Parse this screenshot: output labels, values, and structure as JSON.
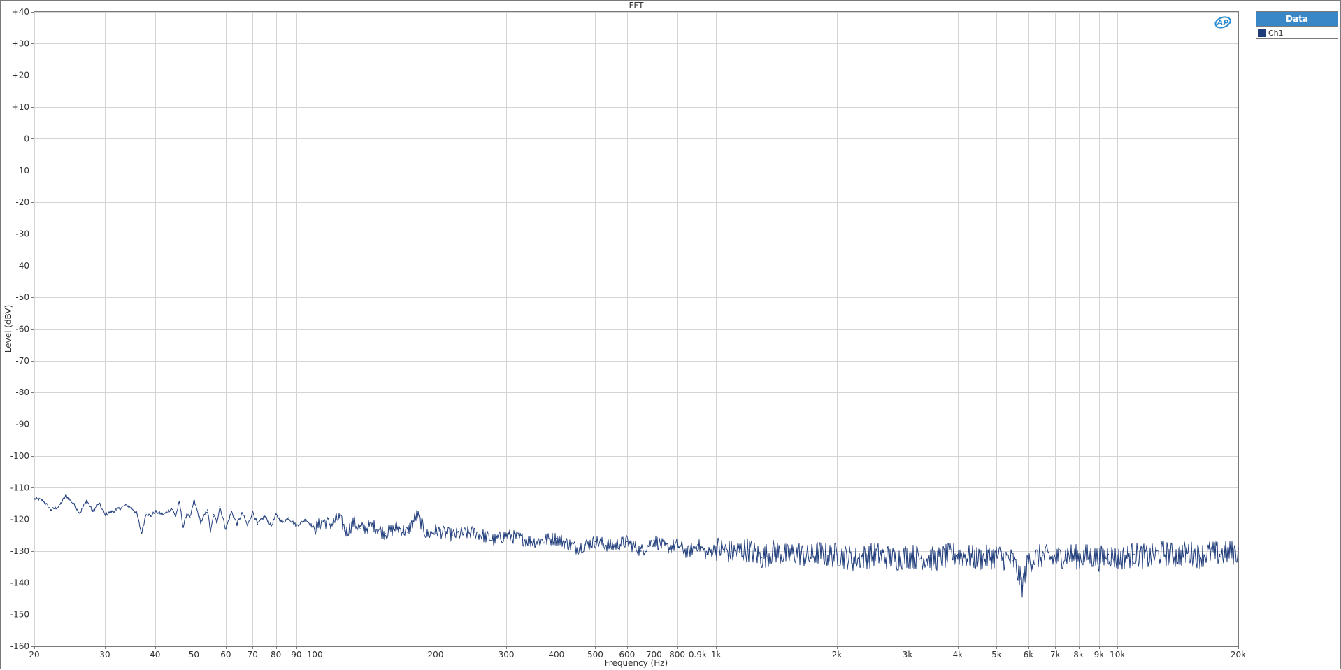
{
  "window": {
    "title": "FFT"
  },
  "legend": {
    "header": "Data",
    "header_color": "#3a87c8",
    "items": [
      {
        "label": "Ch1",
        "color": "#1f3c7a"
      }
    ]
  },
  "logo": {
    "text": "AP",
    "icon": "ap-logo-icon",
    "color": "#2a8bd0"
  },
  "chart_data": {
    "type": "line",
    "title": "FFT",
    "xlabel": "Frequency (Hz)",
    "ylabel": "Level (dBV)",
    "xscale": "log",
    "xlim": [
      20,
      20000
    ],
    "ylim": [
      -160,
      40
    ],
    "grid": true,
    "legend_position": "top-right",
    "x_ticks": [
      {
        "value": 20,
        "label": "20"
      },
      {
        "value": 30,
        "label": "30"
      },
      {
        "value": 40,
        "label": "40"
      },
      {
        "value": 50,
        "label": "50"
      },
      {
        "value": 60,
        "label": "60"
      },
      {
        "value": 70,
        "label": "70"
      },
      {
        "value": 80,
        "label": "80"
      },
      {
        "value": 90,
        "label": "90"
      },
      {
        "value": 100,
        "label": "100"
      },
      {
        "value": 200,
        "label": "200"
      },
      {
        "value": 300,
        "label": "300"
      },
      {
        "value": 400,
        "label": "400"
      },
      {
        "value": 500,
        "label": "500"
      },
      {
        "value": 600,
        "label": "600"
      },
      {
        "value": 700,
        "label": "700"
      },
      {
        "value": 800,
        "label": "800"
      },
      {
        "value": 900,
        "label": "0.9k"
      },
      {
        "value": 1000,
        "label": "1k"
      },
      {
        "value": 2000,
        "label": "2k"
      },
      {
        "value": 3000,
        "label": "3k"
      },
      {
        "value": 4000,
        "label": "4k"
      },
      {
        "value": 5000,
        "label": "5k"
      },
      {
        "value": 6000,
        "label": "6k"
      },
      {
        "value": 7000,
        "label": "7k"
      },
      {
        "value": 8000,
        "label": "8k"
      },
      {
        "value": 9000,
        "label": "9k"
      },
      {
        "value": 10000,
        "label": "10k"
      },
      {
        "value": 20000,
        "label": "20k"
      }
    ],
    "y_ticks": [
      {
        "value": 40,
        "label": "+40"
      },
      {
        "value": 30,
        "label": "+30"
      },
      {
        "value": 20,
        "label": "+20"
      },
      {
        "value": 10,
        "label": "+10"
      },
      {
        "value": 0,
        "label": "0"
      },
      {
        "value": -10,
        "label": "-10"
      },
      {
        "value": -20,
        "label": "-20"
      },
      {
        "value": -30,
        "label": "-30"
      },
      {
        "value": -40,
        "label": "-40"
      },
      {
        "value": -50,
        "label": "-50"
      },
      {
        "value": -60,
        "label": "-60"
      },
      {
        "value": -70,
        "label": "-70"
      },
      {
        "value": -80,
        "label": "-80"
      },
      {
        "value": -90,
        "label": "-90"
      },
      {
        "value": -100,
        "label": "-100"
      },
      {
        "value": -110,
        "label": "-110"
      },
      {
        "value": -120,
        "label": "-120"
      },
      {
        "value": -130,
        "label": "-130"
      },
      {
        "value": -140,
        "label": "-140"
      },
      {
        "value": -150,
        "label": "-150"
      },
      {
        "value": -160,
        "label": "-160"
      }
    ],
    "series": [
      {
        "name": "Ch1",
        "color": "#1f3c7a",
        "x": [
          20,
          21,
          22,
          23,
          24,
          25,
          26,
          27,
          28,
          29,
          30,
          32,
          34,
          35,
          36,
          37,
          38,
          39,
          40,
          42,
          44,
          45,
          46,
          47,
          48,
          49,
          50,
          52,
          54,
          55,
          56,
          57,
          58,
          60,
          62,
          64,
          66,
          68,
          70,
          72,
          75,
          78,
          80,
          83,
          86,
          90,
          95,
          100,
          105,
          110,
          115,
          120,
          125,
          130,
          140,
          150,
          160,
          170,
          180,
          190,
          200,
          220,
          250,
          280,
          300,
          350,
          400,
          450,
          500,
          550,
          600,
          650,
          700,
          750,
          800,
          850,
          900,
          950,
          1000,
          1100,
          1200,
          1300,
          1400,
          1500,
          1600,
          1700,
          1800,
          1900,
          2000,
          2200,
          2500,
          2800,
          3000,
          3500,
          4000,
          4500,
          5000,
          5500,
          5800,
          6000,
          6500,
          7000,
          7500,
          8000,
          8500,
          9000,
          9500,
          10000,
          11000,
          12000,
          13000,
          14000,
          15000,
          16000,
          17000,
          18000,
          19000,
          20000
        ],
        "values": [
          -113.5,
          -114,
          -117,
          -116,
          -112.5,
          -115,
          -118,
          -114,
          -117.5,
          -115,
          -118.5,
          -117,
          -115.5,
          -116.5,
          -118,
          -124.5,
          -118,
          -119,
          -117.5,
          -118.5,
          -116.5,
          -119,
          -114.5,
          -122.5,
          -118,
          -119.5,
          -114,
          -121,
          -117,
          -124,
          -118.5,
          -121,
          -116,
          -123,
          -117.5,
          -121.5,
          -118,
          -122,
          -117.5,
          -121.5,
          -119,
          -122,
          -118.5,
          -121,
          -119.5,
          -122,
          -120,
          -123,
          -120.5,
          -121.5,
          -119.5,
          -124,
          -121,
          -123,
          -122,
          -124.5,
          -122.5,
          -124,
          -118.5,
          -125,
          -123.5,
          -125,
          -124,
          -126.5,
          -125,
          -127,
          -126,
          -129,
          -127,
          -128.5,
          -127,
          -130,
          -126.5,
          -129,
          -128,
          -130.5,
          -128,
          -131,
          -129,
          -130.5,
          -129.5,
          -132,
          -130,
          -131.5,
          -130.5,
          -132,
          -130.5,
          -131.5,
          -131,
          -132.5,
          -131,
          -132.5,
          -131.5,
          -132.5,
          -131,
          -132.5,
          -131.5,
          -133,
          -141,
          -133,
          -131.5,
          -132.5,
          -131,
          -132,
          -131.5,
          -132.5,
          -131,
          -132.5,
          -131,
          -132,
          -130.5,
          -131.5,
          -130.5,
          -131.5,
          -130.5,
          -131,
          -130.5,
          -130.5
        ]
      }
    ]
  }
}
